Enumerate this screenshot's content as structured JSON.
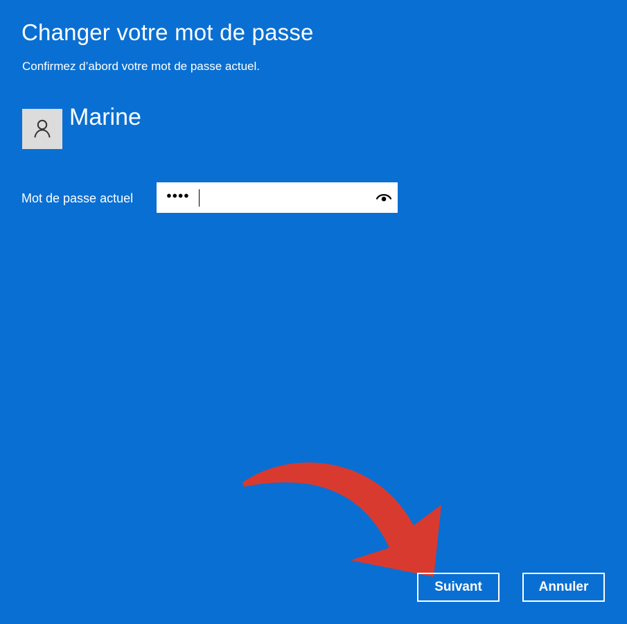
{
  "dialog": {
    "title": "Changer votre mot de passe",
    "subtitle": "Confirmez d’abord votre mot de passe actuel.",
    "user": {
      "name": "Marine",
      "avatar_icon": "person-icon"
    },
    "password": {
      "label": "Mot de passe actuel",
      "value": "●●●●",
      "reveal_icon": "eye-icon"
    },
    "actions": {
      "next": "Suivant",
      "cancel": "Annuler"
    },
    "annotation": {
      "icon": "red-arrow-icon",
      "color": "#d93a2f"
    }
  },
  "colors": {
    "background": "#0a6fd2",
    "text": "#ffffff",
    "input": "#ffffff",
    "avatar_bg": "#dcdcdc",
    "accent": "#d93a2f"
  }
}
